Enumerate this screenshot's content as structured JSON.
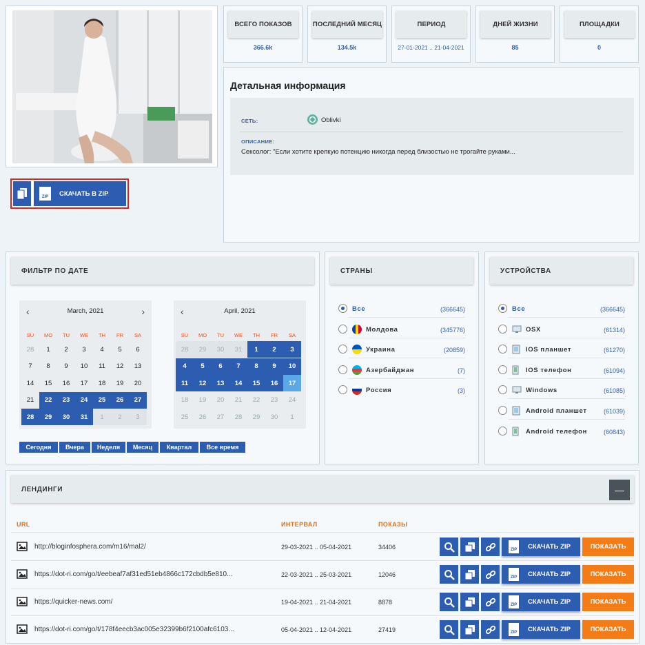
{
  "stats": [
    {
      "label": "ВСЕГО ПОКАЗОВ",
      "value": "366.6k"
    },
    {
      "label": "ПОСЛЕДНИЙ МЕСЯЦ",
      "value": "134.5k"
    },
    {
      "label": "ПЕРИОД",
      "value": "27-01-2021 .. 21-04-2021"
    },
    {
      "label": "ДНЕЙ ЖИЗНИ",
      "value": "85"
    },
    {
      "label": "ПЛОЩАДКИ",
      "value": "0"
    }
  ],
  "detail": {
    "title": "Детальная информация",
    "network_label": "СЕТЬ:",
    "network_value": "Oblivki",
    "description_label": "ОПИСАНИЕ:",
    "description_value": "Сексолог: \"Если хотите крепкую потенцию никогда перед близостью не трогайте руками..."
  },
  "download": {
    "label": "СКАЧАТЬ В ZIP",
    "zip": "ZIP"
  },
  "date_filter": {
    "title": "ФИЛЬТР ПО ДАТЕ",
    "dows": [
      "SU",
      "MO",
      "TU",
      "WE",
      "TH",
      "FR",
      "SA"
    ],
    "calendars": [
      {
        "month": "March, 2021",
        "prev": "‹",
        "next": "›"
      },
      {
        "month": "April, 2021",
        "prev": "‹",
        "next": ""
      }
    ],
    "quick": [
      "Сегодня",
      "Вчера",
      "Неделя",
      "Месяц",
      "Квартал",
      "Все время"
    ]
  },
  "countries": {
    "title": "СТРАНЫ",
    "items": [
      {
        "label": "Все",
        "count": "(366645)",
        "flag": "none"
      },
      {
        "label": "Молдова",
        "count": "(345776)",
        "flag": "moldova"
      },
      {
        "label": "Украина",
        "count": "(20859)",
        "flag": "ukraine"
      },
      {
        "label": "Азербайджан",
        "count": "(7)",
        "flag": "azerbaijan"
      },
      {
        "label": "Россия",
        "count": "(3)",
        "flag": "russia"
      }
    ]
  },
  "devices": {
    "title": "УСТРОЙСТВА",
    "items": [
      {
        "label": "Все",
        "count": "(366645)",
        "icon": "none"
      },
      {
        "label": "OSX",
        "count": "(61314)",
        "icon": "monitor-icon"
      },
      {
        "label": "IOS планшет",
        "count": "(61270)",
        "icon": "tablet-icon"
      },
      {
        "label": "IOS телефон",
        "count": "(61094)",
        "icon": "phone-icon"
      },
      {
        "label": "Windows",
        "count": "(61085)",
        "icon": "monitor-icon"
      },
      {
        "label": "Android планшет",
        "count": "(61039)",
        "icon": "tablet-icon"
      },
      {
        "label": "Android телефон",
        "count": "(60843)",
        "icon": "phone-icon"
      }
    ]
  },
  "landings": {
    "title": "ЛЕНДИНГИ",
    "collapse": "—",
    "headers": {
      "url": "URL",
      "interval": "ИНТЕРВАЛ",
      "shows": "ПОКАЗЫ"
    },
    "download_label": "СКАЧАТЬ ZIP",
    "show_label": "ПОКАЗАТЬ",
    "rows": [
      {
        "url": "http://bloginfosphera.com/m16/mal2/",
        "interval": "29-03-2021 .. 05-04-2021",
        "shows": "34406"
      },
      {
        "url": "https://dot-ri.com/go/t/eebeaf7af31ed51eb4866c172cbdb5e810...",
        "interval": "22-03-2021 .. 25-03-2021",
        "shows": "12046"
      },
      {
        "url": "https://quicker-news.com/",
        "interval": "19-04-2021 .. 21-04-2021",
        "shows": "8878"
      },
      {
        "url": "https://dot-ri.com/go/t/178f4eecb3ac005e32399b6f2100afc6103...",
        "interval": "05-04-2021 .. 12-04-2021",
        "shows": "27419"
      }
    ]
  },
  "colors": {
    "accent": "#2c5db0",
    "orange": "#f47c16",
    "highlight": "#e02020",
    "today": "#5aa8e6"
  }
}
